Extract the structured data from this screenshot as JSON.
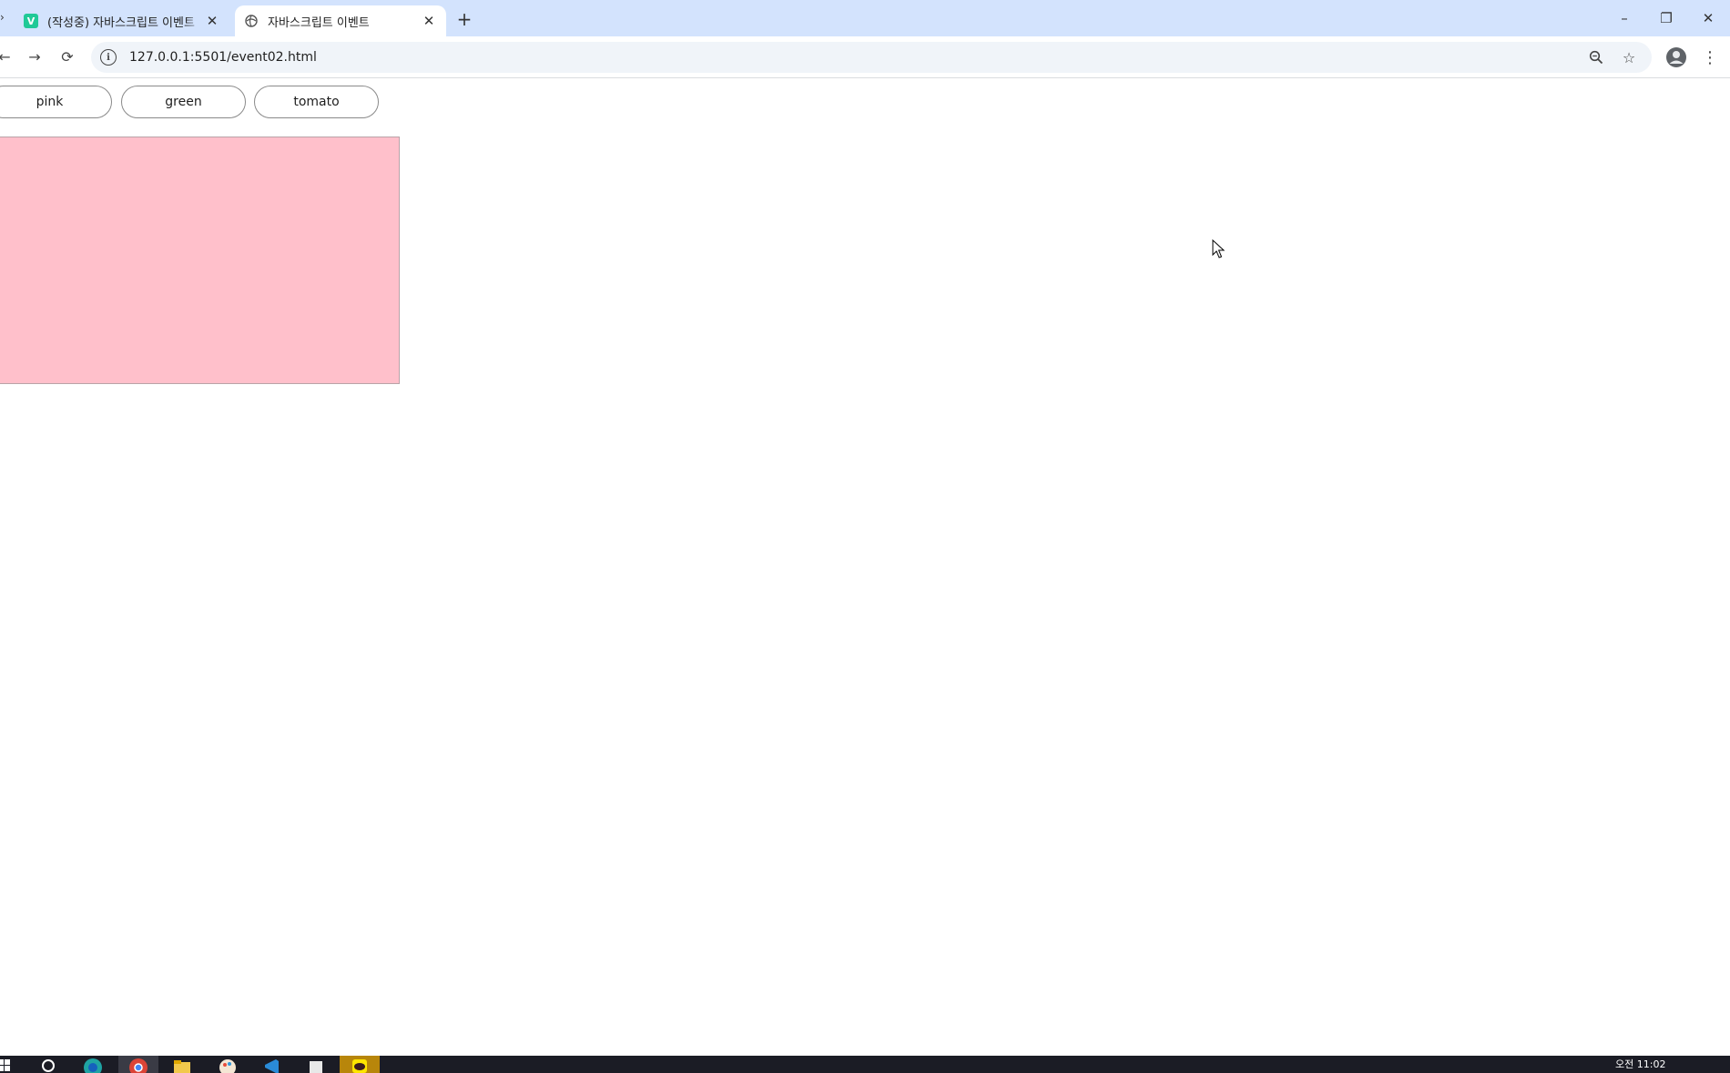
{
  "browser": {
    "tabs": [
      {
        "title": "(작성중) 자바스크립트 이벤트",
        "favicon": "velog-v-icon",
        "active": false,
        "close_label": "✕"
      },
      {
        "title": "자바스크립트 이벤트",
        "favicon": "globe-icon",
        "active": true,
        "close_label": "✕"
      }
    ],
    "new_tab_label": "+",
    "window_controls": {
      "minimize": "–",
      "restore": "❐",
      "close": "✕"
    },
    "nav": {
      "back": "←",
      "forward": "→",
      "reload": "⟳"
    },
    "address": {
      "info_icon": "i",
      "url": "127.0.0.1:5501/event02.html"
    },
    "toolbar_icons": {
      "zoom": "⌕",
      "bookmark": "☆",
      "menu": "⋮"
    }
  },
  "page": {
    "buttons": [
      {
        "label": "pink",
        "color": "#ffc0cb"
      },
      {
        "label": "green",
        "color": "#008000"
      },
      {
        "label": "tomato",
        "color": "#ff6347"
      }
    ],
    "box": {
      "current_color": "#ffc0cb"
    }
  },
  "taskbar": {
    "icons": [
      "search-icon",
      "edge-icon",
      "chrome-icon",
      "file-explorer-icon",
      "paint-icon",
      "vscode-icon",
      "app-icon",
      "kakaotalk-icon"
    ],
    "clock": "오전 11:02"
  },
  "colors": {
    "tabstrip_bg": "#d3e3fd",
    "omnibox_bg": "#f0f4f9",
    "taskbar_bg": "#1b1c25"
  }
}
